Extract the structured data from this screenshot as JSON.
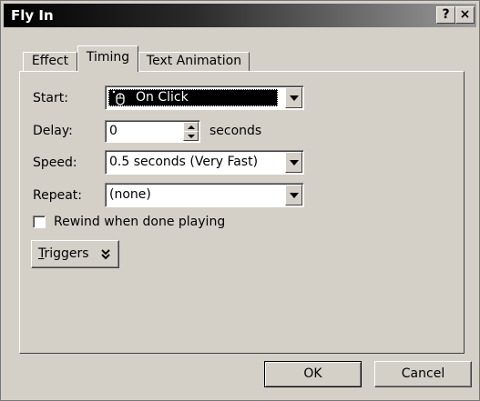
{
  "window": {
    "title": "Fly In",
    "help_button": "?",
    "close_button": "×"
  },
  "tabs": [
    {
      "label": "Effect",
      "selected": false
    },
    {
      "label": "Timing",
      "selected": true
    },
    {
      "label": "Text Animation",
      "selected": false
    }
  ],
  "form": {
    "start": {
      "label": "Start:",
      "value": "On Click",
      "icon": "mouse-click-icon"
    },
    "delay": {
      "label": "Delay:",
      "value": "0",
      "unit": "seconds"
    },
    "speed": {
      "label": "Speed:",
      "value": "0.5 seconds (Very Fast)"
    },
    "repeat": {
      "label": "Repeat:",
      "value": "(none)"
    },
    "rewind": {
      "label": "Rewind when done playing",
      "checked": false
    },
    "triggers": {
      "label": "Triggers",
      "accelerator": "T",
      "rest": "riggers",
      "icon": "double-chevron-down-icon"
    }
  },
  "buttons": {
    "ok": "OK",
    "cancel": "Cancel"
  },
  "colors": {
    "dialog_bg": "#d4d0c8",
    "selected_field_bg": "#000000",
    "selected_field_text": "#ffffff"
  }
}
